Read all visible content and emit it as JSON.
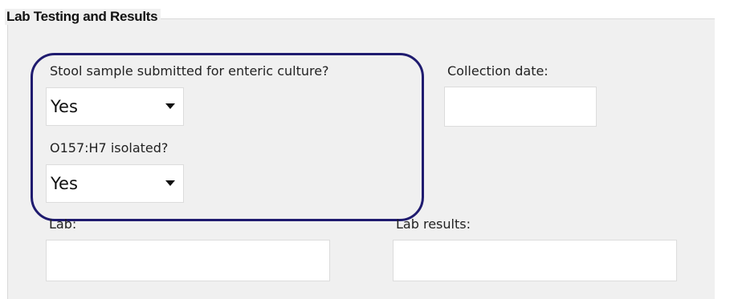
{
  "section": {
    "title": "Lab Testing and Results"
  },
  "stool_sample": {
    "label": "Stool sample submitted for enteric culture?",
    "value": "Yes"
  },
  "collection_date": {
    "label": "Collection date:",
    "value": ""
  },
  "o157": {
    "label": "O157:H7 isolated?",
    "value": "Yes"
  },
  "lab": {
    "label": "Lab:",
    "value": ""
  },
  "lab_results": {
    "label": "Lab results:",
    "value": ""
  },
  "colors": {
    "highlight": "#1f1b6f",
    "panel": "#f0f0f0"
  },
  "icons": {
    "dropdown": "chevron-down-icon"
  }
}
